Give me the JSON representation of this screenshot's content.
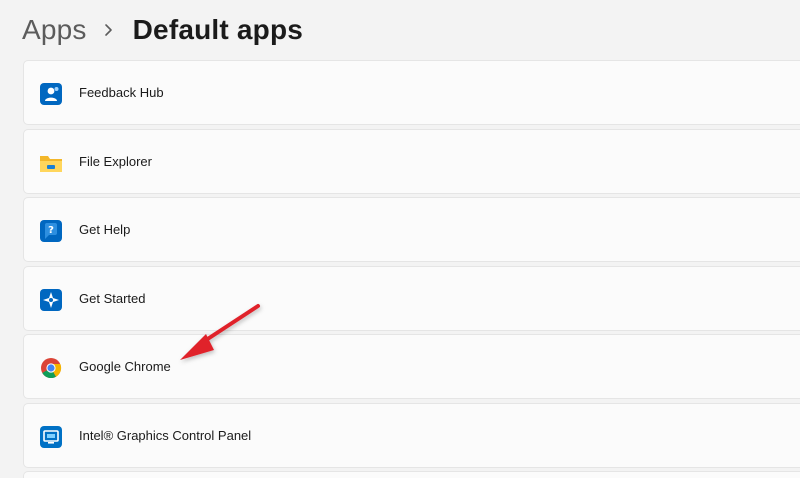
{
  "breadcrumb": {
    "parent": "Apps",
    "current": "Default apps"
  },
  "apps": [
    {
      "label": "Feedback Hub",
      "icon": "feedback-hub-icon"
    },
    {
      "label": "File Explorer",
      "icon": "file-explorer-icon"
    },
    {
      "label": "Get Help",
      "icon": "get-help-icon"
    },
    {
      "label": "Get Started",
      "icon": "get-started-icon"
    },
    {
      "label": "Google Chrome",
      "icon": "chrome-icon"
    },
    {
      "label": "Intel® Graphics Control Panel",
      "icon": "intel-graphics-icon"
    }
  ],
  "colors": {
    "background": "#f3f3f3",
    "card": "#fbfbfb",
    "accent_blue": "#0067c0",
    "annotation_arrow": "#e0222c"
  }
}
